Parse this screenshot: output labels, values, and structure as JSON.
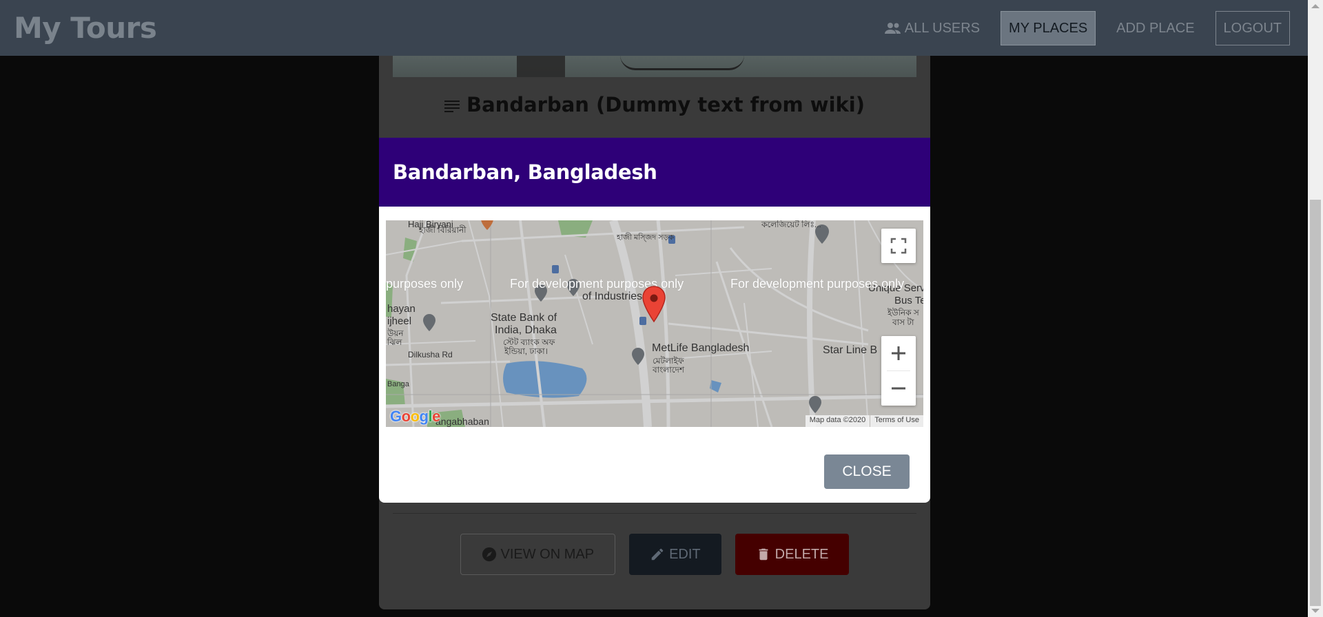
{
  "header": {
    "brand": "My Tours",
    "nav": [
      {
        "label": "ALL USERS",
        "icon": "users-icon"
      },
      {
        "label": "MY PLACES"
      },
      {
        "label": "ADD PLACE"
      },
      {
        "label": "LOGOUT"
      }
    ]
  },
  "place": {
    "title": "Bandarban (Dummy text from wiki)",
    "actions": {
      "view_on_map": "VIEW ON MAP",
      "edit": "EDIT",
      "delete": "DELETE"
    }
  },
  "modal": {
    "title": "Bandarban, Bangladesh",
    "close_label": "CLOSE",
    "map": {
      "dev_watermark_left": "purposes only",
      "dev_watermark_center": "For development purposes only",
      "dev_watermark_right": "For development purposes only",
      "attribution_data": "Map data ©2020",
      "attribution_terms": "Terms of Use",
      "google_logo": "Google",
      "labels": {
        "haji_biryani": "Haji Biryani",
        "haji_biryani_bn": "হাজী বিরিয়ানী",
        "top_bn": "কলেজিয়েট লিঃ...",
        "road_bn": "হাজী মস্জিদ সড়ক",
        "industries": "of Industries",
        "state_bank_1": "State Bank of",
        "state_bank_2": "India, Dhaka",
        "state_bank_bn_1": "স্টেট ব্যাংক অফ",
        "state_bank_bn_2": "ইন্ডিয়া, ঢাকা।",
        "dilkusha": "Dilkusha Rd",
        "metlife": "MetLife Bangladesh",
        "metlife_bn_1": "মেটলাইফ",
        "metlife_bn_2": "বাংলাদেশ",
        "star_line": "Star Line B",
        "bus_1": "Unique Serv",
        "bus_2": "Bus Term",
        "bus_bn_1": "ইউনিক স",
        "bus_bn_2": "বাস টা",
        "motijheel_1": "hayan",
        "motijheel_2": "ijheel",
        "motijheel_bn": "উয়ন",
        "motijheel_bn2": "ঝিল",
        "bangabhaban": "angabhaban",
        "banga": "Banga"
      }
    }
  },
  "colors": {
    "modal_header": "#2e0078",
    "close_button": "#7a8795",
    "marker": "#ea4335"
  }
}
